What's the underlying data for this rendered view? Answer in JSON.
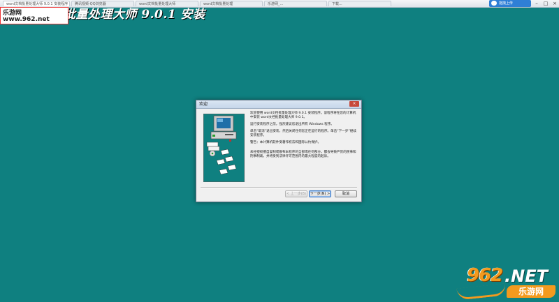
{
  "browser": {
    "tabs": [
      {
        "label": "word文档批量处理大师 9.0.1 安装程序"
      },
      {
        "label": "腾讯视频-QQ浏览器"
      },
      {
        "label": "word文档批量处理大师"
      },
      {
        "label": "word文档批量处理"
      },
      {
        "label": "乐游网_..."
      },
      {
        "label": "下载..."
      }
    ],
    "upload_label": "拖拽上传",
    "controls": {
      "minimize": "–",
      "maximize": "□",
      "close": "×"
    }
  },
  "installer": {
    "title": "Word文档批量处理大师 9.0.1 安装"
  },
  "watermark_top": {
    "line1": "乐游网",
    "line2": "www.962.net"
  },
  "dialog": {
    "title": "欢迎",
    "close": "×",
    "paragraphs": [
      "欢迎使用 word文档批量处理大师 9.0.1 安装程序。该程序将在您的计算机中安装 word文档批量处理大师 9.0.1。",
      "运行安装程序之前，强烈建议您退出所有 Windows 程序。",
      "单击“取消”退出安装，然后关闭任何您正在运行的程序。单击“下一步”继续安装程序。",
      "警告：本计算机软件受著作权法和国际公约保护。",
      "未经授权擅自复制或散布本程序的全部或任何部分，都会导致严厉的民事和刑事制裁，并将受到法律许可范围内的最大程度的起诉。"
    ],
    "buttons": {
      "back": "< 上一步(B)",
      "next": "下一步(N) >",
      "cancel": "取消"
    }
  },
  "watermark_bottom": {
    "number": "962",
    "dotnet": ".NET",
    "site": "乐游网"
  },
  "colors": {
    "desktop": "#0f8080",
    "accent_orange": "#f39a1e"
  }
}
